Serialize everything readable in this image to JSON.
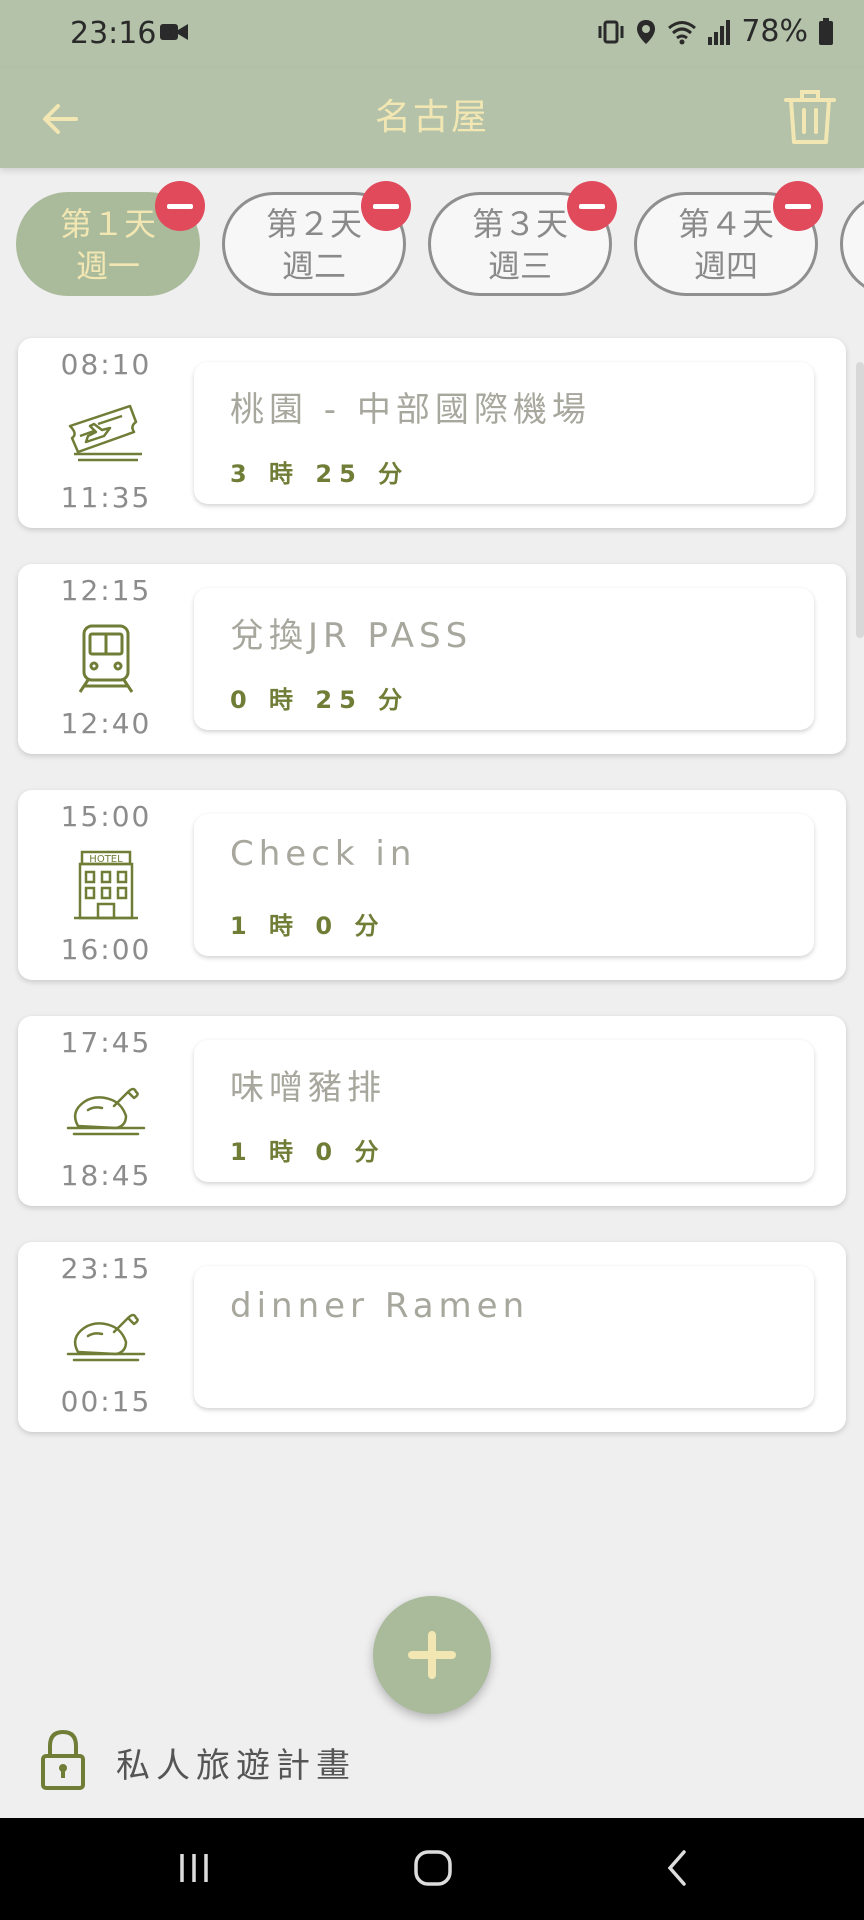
{
  "status": {
    "time": "23:16",
    "battery": "78%"
  },
  "app": {
    "title": "名古屋"
  },
  "colors": {
    "bar": "#b3c2a8",
    "accent": "#aabb9c",
    "title": "#f2e7b3",
    "delete": "#e04a5b",
    "duration": "#6f7d37"
  },
  "day_tabs": [
    {
      "day": "第１天",
      "weekday": "週一",
      "active": true
    },
    {
      "day": "第２天",
      "weekday": "週二",
      "active": false
    },
    {
      "day": "第３天",
      "weekday": "週三",
      "active": false
    },
    {
      "day": "第４天",
      "weekday": "週四",
      "active": false
    }
  ],
  "schedule": [
    {
      "start": "08:10",
      "end": "11:35",
      "icon": "plane-ticket-icon",
      "title": "桃園 - 中部國際機場",
      "duration": "3 時 25 分"
    },
    {
      "start": "12:15",
      "end": "12:40",
      "icon": "train-icon",
      "title": "兌換JR PASS",
      "duration": "0 時 25 分"
    },
    {
      "start": "15:00",
      "end": "16:00",
      "icon": "hotel-icon",
      "title": "Check in",
      "duration": "1 時 0 分"
    },
    {
      "start": "17:45",
      "end": "18:45",
      "icon": "roast-chicken-icon",
      "title": "味噌豬排",
      "duration": "1 時 0 分"
    },
    {
      "start": "23:15",
      "end": "00:15",
      "icon": "roast-chicken-icon",
      "title": "dinner Ramen",
      "duration": ""
    }
  ],
  "footer": {
    "privacy_label": "私人旅遊計畫"
  }
}
